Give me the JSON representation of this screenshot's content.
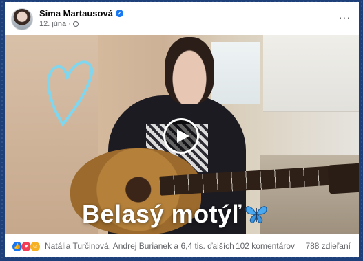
{
  "post": {
    "author": "Sima Martausová",
    "date": "12. júna",
    "date_separator": "·",
    "more_label": "···"
  },
  "video": {
    "caption": "Belasý motýľ"
  },
  "footer": {
    "reactors": "Natália Turčinová, Andrej Burianek a 6,4 tis. ďalších",
    "comments": "102 komentárov",
    "shares": "788 zdieľaní"
  },
  "colors": {
    "verified": "#1877f2",
    "background": "#1d3f7a",
    "like": "#1877f2",
    "love": "#f33e58",
    "care": "#f7b125",
    "heart_doodle": "#7fd6ef",
    "butterfly": "#4aa8f0"
  },
  "icons": [
    "verified-badge-icon",
    "globe-icon",
    "more-icon",
    "play-icon",
    "heart-doodle-icon",
    "butterfly-icon",
    "like-reaction-icon",
    "love-reaction-icon",
    "care-reaction-icon"
  ]
}
